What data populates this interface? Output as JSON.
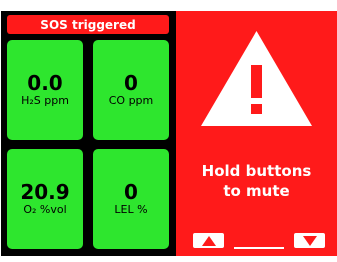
{
  "colors": {
    "background": "#ffffff",
    "panel_dark": "#000000",
    "alarm_red": "#ff1a1a",
    "tile_green": "#2ee62e",
    "text_dark": "#000000",
    "text_light": "#ffffff"
  },
  "banner": {
    "label": "SOS triggered"
  },
  "readings": [
    {
      "value": "0.0",
      "unit": "H₂S ppm"
    },
    {
      "value": "0",
      "unit": "CO ppm"
    },
    {
      "value": "20.9",
      "unit": "O₂ %vol"
    },
    {
      "value": "0",
      "unit": "LEL %"
    }
  ],
  "alert": {
    "icon": "warning-triangle-icon",
    "message_line1": "Hold buttons",
    "message_line2": "to mute"
  },
  "nav": {
    "up_icon": "triangle-up-icon",
    "down_icon": "triangle-down-icon"
  }
}
